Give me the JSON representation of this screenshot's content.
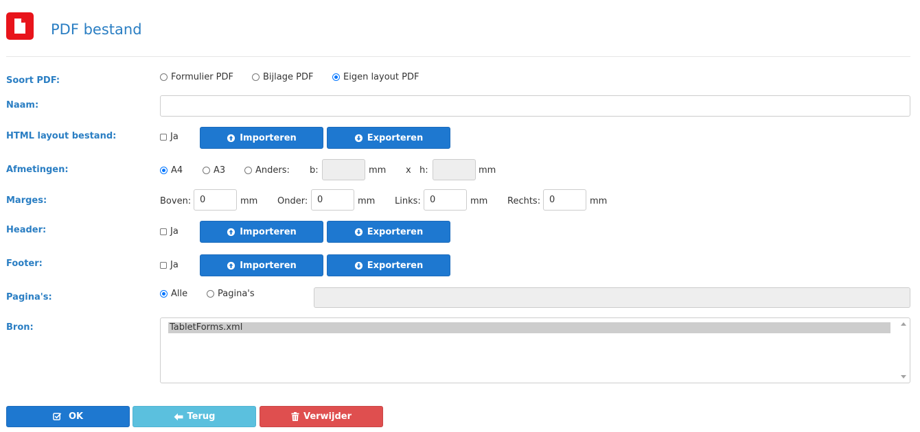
{
  "header": {
    "title": "PDF bestand",
    "icon": "pdf-file-icon",
    "icon_color": "#e8141b"
  },
  "labels": {
    "soort": "Soort PDF:",
    "naam": "Naam:",
    "html_layout": "HTML layout bestand:",
    "afmetingen": "Afmetingen:",
    "marges": "Marges:",
    "header": "Header:",
    "footer": "Footer:",
    "paginas": "Pagina's:",
    "bron": "Bron:"
  },
  "soort_options": [
    {
      "label": "Formulier PDF",
      "selected": false
    },
    {
      "label": "Bijlage PDF",
      "selected": false
    },
    {
      "label": "Eigen layout PDF",
      "selected": true
    }
  ],
  "naam": {
    "value": ""
  },
  "html_layout": {
    "ja_label": "Ja",
    "checked": false,
    "import_label": "Importeren",
    "export_label": "Exporteren"
  },
  "afmetingen": {
    "options": [
      {
        "label": "A4",
        "selected": true
      },
      {
        "label": "A3",
        "selected": false
      },
      {
        "label": "Anders:",
        "selected": false
      }
    ],
    "b_label": "b:",
    "b_value": "",
    "b_unit": "mm",
    "x_label": "x",
    "h_label": "h:",
    "h_value": "",
    "h_unit": "mm"
  },
  "marges": {
    "boven_label": "Boven:",
    "boven_value": "0",
    "onder_label": "Onder:",
    "onder_value": "0",
    "links_label": "Links:",
    "links_value": "0",
    "rechts_label": "Rechts:",
    "rechts_value": "0",
    "unit": "mm"
  },
  "header_row": {
    "ja_label": "Ja",
    "checked": false,
    "import_label": "Importeren",
    "export_label": "Exporteren"
  },
  "footer_row": {
    "ja_label": "Ja",
    "checked": false,
    "import_label": "Importeren",
    "export_label": "Exporteren"
  },
  "paginas": {
    "options": [
      {
        "label": "Alle",
        "selected": true
      },
      {
        "label": "Pagina's",
        "selected": false
      }
    ],
    "value": ""
  },
  "bron": {
    "items": [
      "TabletForms.xml"
    ]
  },
  "footer_buttons": {
    "ok": "OK",
    "terug": "Terug",
    "verwijder": "Verwijder"
  },
  "colors": {
    "accent": "#2a7ec3",
    "primary": "#1e78d0",
    "info": "#5bc0de",
    "danger": "#df4f4f"
  }
}
